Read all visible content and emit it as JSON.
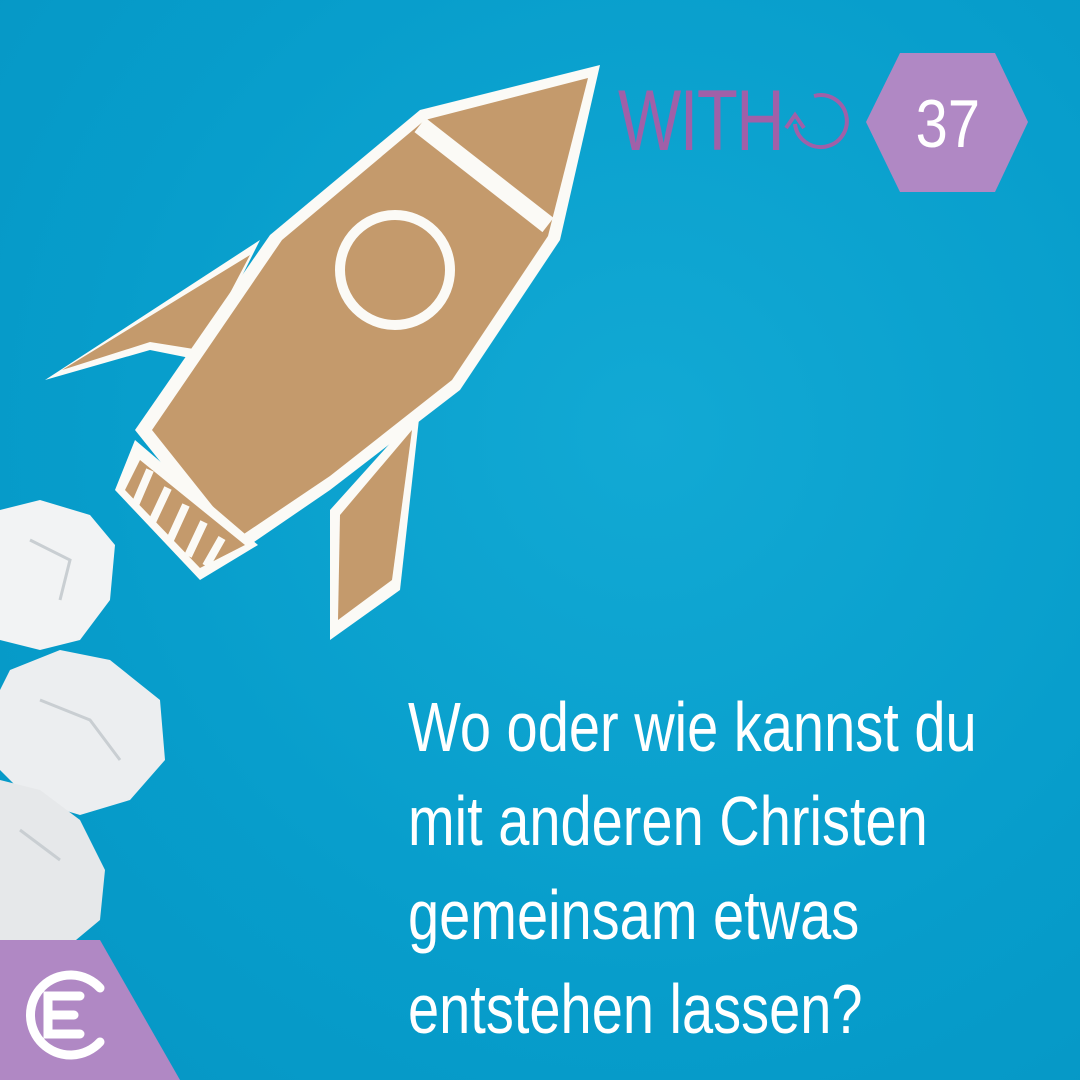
{
  "brand": {
    "series_label": "WITH",
    "episode_number": "37",
    "logo_text": "E"
  },
  "question": {
    "lines": [
      "Wo oder wie kannst du",
      "mit anderen Christen",
      "gemeinsam etwas",
      "entstehen lassen?"
    ]
  },
  "colors": {
    "background": "#0aa2cf",
    "accent_purple": "#b088c4",
    "with_text": "#a060a8",
    "cardboard": "#c49a6c",
    "text": "#ffffff"
  }
}
